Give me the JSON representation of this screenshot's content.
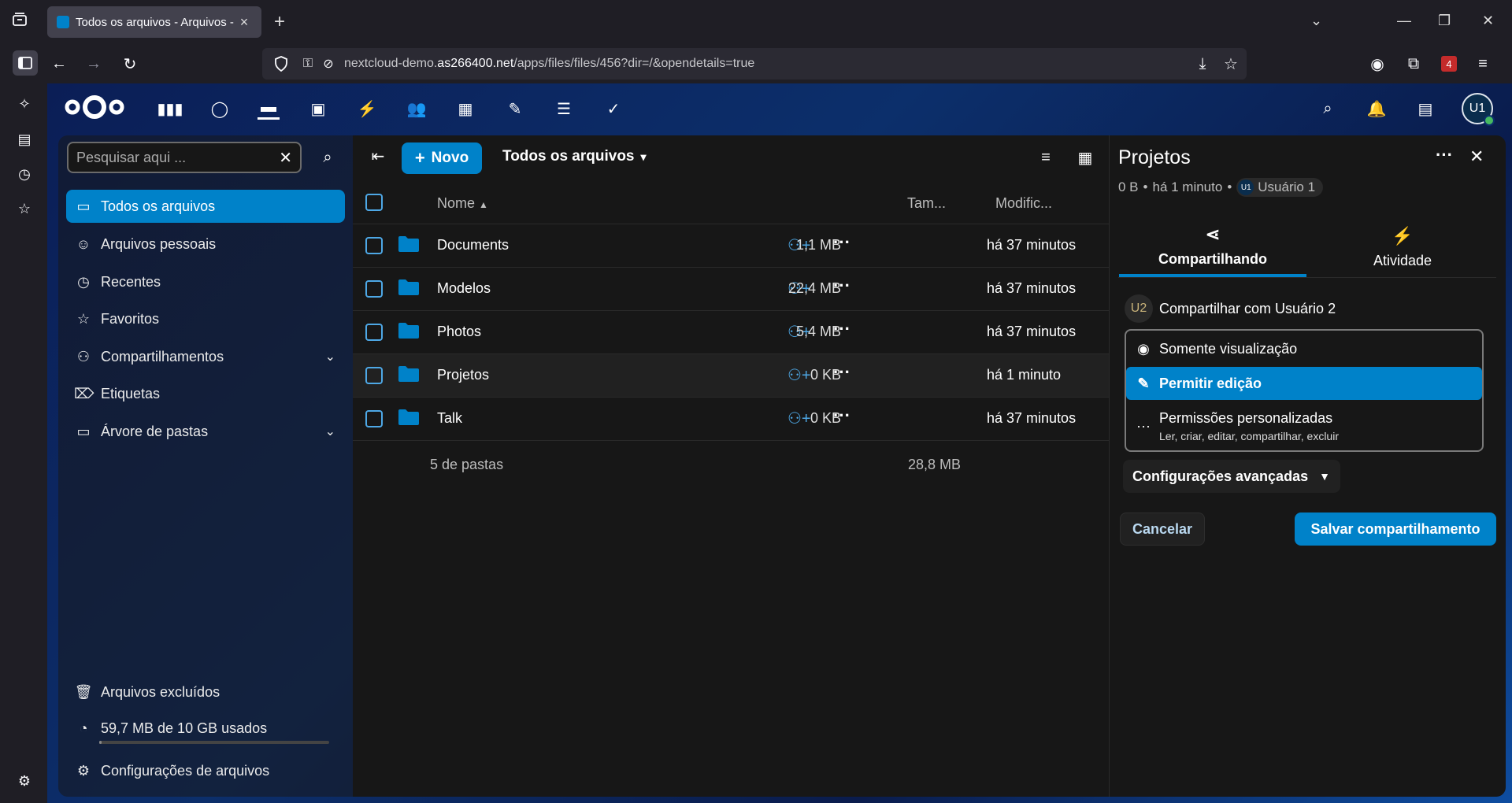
{
  "browser": {
    "tab_title": "Todos os arquivos - Arquivos - Nextcloud",
    "new_tab": "+",
    "url_prefix": "nextcloud-demo.",
    "url_host": "as266400.net",
    "url_path": "/apps/files/files/456?dir=/&opendetails=true",
    "extensions_badge": "4"
  },
  "header": {
    "avatar_initials": "U1"
  },
  "nav": {
    "search_placeholder": "Pesquisar aqui ...",
    "items": [
      {
        "label": "Todos os arquivos"
      },
      {
        "label": "Arquivos pessoais"
      },
      {
        "label": "Recentes"
      },
      {
        "label": "Favoritos"
      },
      {
        "label": "Compartilhamentos"
      },
      {
        "label": "Etiquetas"
      },
      {
        "label": "Árvore de pastas"
      }
    ],
    "deleted_files": "Arquivos excluídos",
    "quota": "59,7 MB de 10 GB usados",
    "quota_fraction": 0.006,
    "settings": "Configurações de arquivos"
  },
  "files": {
    "new_label": "Novo",
    "breadcrumb": "Todos os arquivos",
    "columns": {
      "name": "Nome",
      "size": "Tam...",
      "modified": "Modific..."
    },
    "rows": [
      {
        "name": "Documents",
        "size": "1,1 MB",
        "modified": "há 37 minutos"
      },
      {
        "name": "Modelos",
        "size": "22,4 MB",
        "modified": "há 37 minutos"
      },
      {
        "name": "Photos",
        "size": "5,4 MB",
        "modified": "há 37 minutos"
      },
      {
        "name": "Projetos",
        "size": "0 KB",
        "modified": "há 1 minuto"
      },
      {
        "name": "Talk",
        "size": "0 KB",
        "modified": "há 37 minutos"
      }
    ],
    "summary_count": "5 de pastas",
    "summary_size": "28,8 MB"
  },
  "details": {
    "title": "Projetos",
    "size": "0 B",
    "time": "há 1 minuto",
    "owner_initials": "U1",
    "owner": "Usuário 1",
    "tab_share": "Compartilhando",
    "tab_activity": "Atividade",
    "share_with_initials": "U2",
    "share_with": "Compartilhar com Usuário 2",
    "perm_view": "Somente visualização",
    "perm_edit": "Permitir edição",
    "perm_custom": "Permissões personalizadas",
    "perm_custom_desc": "Ler, criar, editar, compartilhar, excluir",
    "advanced": "Configurações avançadas",
    "cancel": "Cancelar",
    "save": "Salvar compartilhamento"
  },
  "colors": {
    "accent": "#0082c9",
    "background": "#171717"
  }
}
